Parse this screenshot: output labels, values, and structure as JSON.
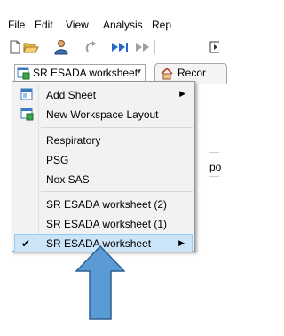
{
  "menubar": {
    "items": [
      "File",
      "Edit",
      "View",
      "Analysis",
      "Rep"
    ]
  },
  "toolbar": {
    "icons": [
      "new-document-icon",
      "open-folder-icon",
      "user-icon",
      "redo-icon",
      "play-icon",
      "fast-forward-icon",
      "step-icon"
    ]
  },
  "workspace": {
    "current": "SR ESADA worksheet",
    "record_tab": "Recor"
  },
  "background": {
    "partial_text": "po"
  },
  "menu": {
    "items": [
      {
        "label": "Add Sheet",
        "has_submenu": true,
        "icon": "add-sheet-icon"
      },
      {
        "label": "New Workspace Layout",
        "icon": "workspace-layout-icon"
      },
      {
        "label": "Respiratory"
      },
      {
        "label": "PSG"
      },
      {
        "label": "Nox SAS"
      },
      {
        "label": "SR ESADA worksheet (2)"
      },
      {
        "label": "SR ESADA worksheet (1)"
      },
      {
        "label": "SR ESADA worksheet",
        "checked": true,
        "selected": true,
        "has_submenu": true
      }
    ],
    "check_glyph": "✔",
    "submenu_glyph": "▶"
  },
  "annotation": {
    "arrow_color": "#5b9bd5",
    "arrow_outline": "#2e5f8f",
    "direction": "up"
  }
}
